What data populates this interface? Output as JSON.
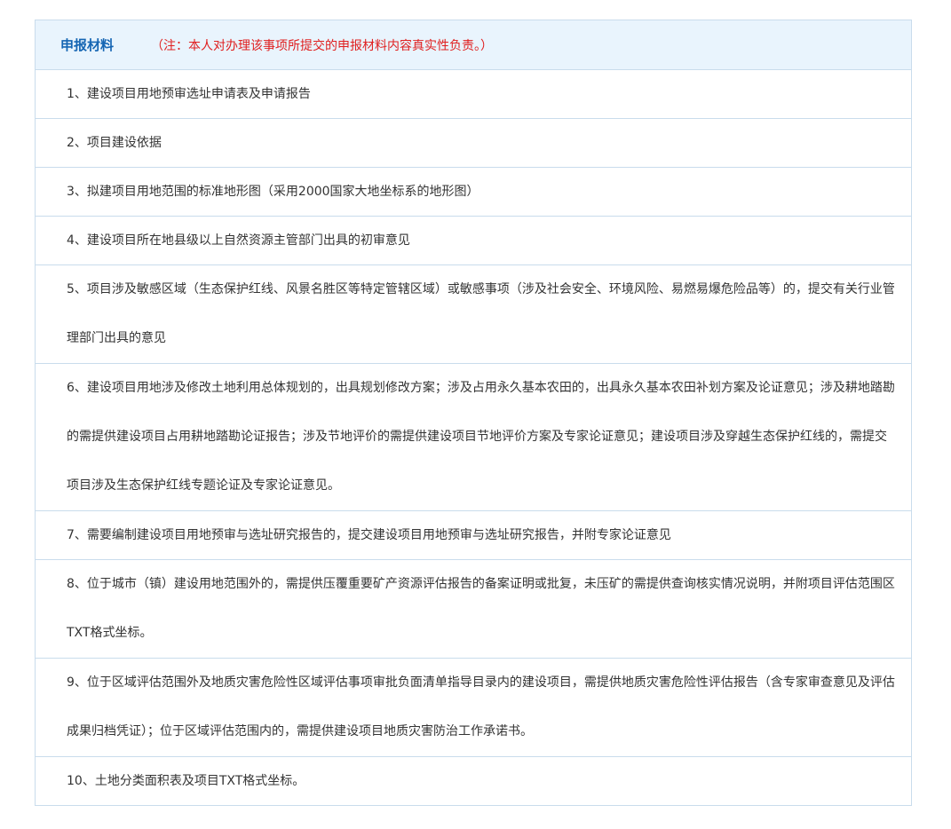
{
  "header": {
    "title": "申报材料",
    "note": "（注：本人对办理该事项所提交的申报材料内容真实性负责。）"
  },
  "items": [
    {
      "text": "1、建设项目用地预审选址申请表及申请报告"
    },
    {
      "text": "2、项目建设依据"
    },
    {
      "text": "3、拟建项目用地范围的标准地形图（采用2000国家大地坐标系的地形图）"
    },
    {
      "text": "4、建设项目所在地县级以上自然资源主管部门出具的初审意见"
    },
    {
      "text": "5、项目涉及敏感区域（生态保护红线、风景名胜区等特定管辖区域）或敏感事项（涉及社会安全、环境风险、易燃易爆危险品等）的，提交有关行业管理部门出具的意见"
    },
    {
      "text": "6、建设项目用地涉及修改土地利用总体规划的，出具规划修改方案；涉及占用永久基本农田的，出具永久基本农田补划方案及论证意见；涉及耕地踏勘的需提供建设项目占用耕地踏勘论证报告；涉及节地评价的需提供建设项目节地评价方案及专家论证意见；建设项目涉及穿越生态保护红线的，需提交项目涉及生态保护红线专题论证及专家论证意见。"
    },
    {
      "text": "7、需要编制建设项目用地预审与选址研究报告的，提交建设项目用地预审与选址研究报告，并附专家论证意见"
    },
    {
      "text": "8、位于城市（镇）建设用地范围外的，需提供压覆重要矿产资源评估报告的备案证明或批复，未压矿的需提供查询核实情况说明，并附项目评估范围区TXT格式坐标。"
    },
    {
      "text": "9、位于区域评估范围外及地质灾害危险性区域评估事项审批负面清单指导目录内的建设项目，需提供地质灾害危险性评估报告（含专家审查意见及评估成果归档凭证）；位于区域评估范围内的，需提供建设项目地质灾害防治工作承诺书。"
    },
    {
      "text": "10、土地分类面积表及项目TXT格式坐标。"
    }
  ]
}
